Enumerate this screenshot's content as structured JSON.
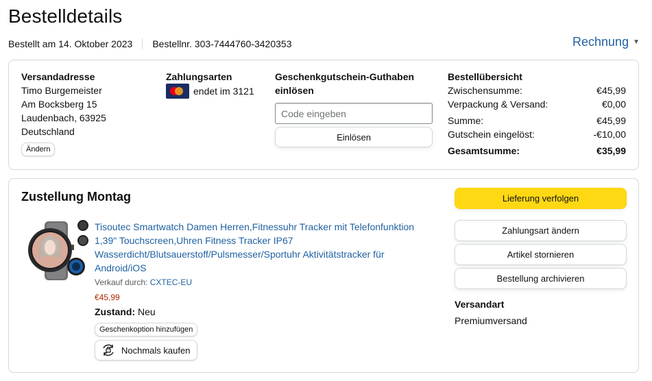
{
  "header": {
    "title": "Bestelldetails",
    "ordered_on": "Bestellt am 14. Oktober 2023",
    "order_number": "Bestellnr. 303-7444760-3420353",
    "invoice_label": "Rechnung"
  },
  "address": {
    "title": "Versandadresse",
    "name": "Timo Burgemeister",
    "street": "Am Bocksberg 15",
    "city": "Laudenbach, 63925",
    "country": "Deutschland",
    "change_label": "Ändern"
  },
  "payment": {
    "title": "Zahlungsarten",
    "card_text": "endet im 3121",
    "card_icon": "mastercard-icon"
  },
  "gift": {
    "title": "Geschenkgutschein-Guthaben einlösen",
    "placeholder": "Code eingeben",
    "redeem_label": "Einlösen"
  },
  "summary": {
    "title": "Bestellübersicht",
    "rows": [
      {
        "label": "Zwischensumme:",
        "value": "€45,99"
      },
      {
        "label": "Verpackung & Versand:",
        "value": "€0,00"
      },
      {
        "label": "Summe:",
        "value": "€45,99"
      },
      {
        "label": "Gutschein eingelöst:",
        "value": "-€10,00"
      }
    ],
    "total_label": "Gesamtsumme:",
    "total_value": "€35,99"
  },
  "delivery": {
    "title": "Zustellung Montag",
    "product": {
      "title": "Tisoutec Smartwatch Damen Herren,Fitnessuhr Tracker mit Telefonfunktion 1,39\" Touchscreen,Uhren Fitness Tracker IP67 Wasserdicht/Blutsauerstoff/Pulsmesser/Sportuhr Aktivitätstracker für Android/iOS",
      "seller_prefix": "Verkauf durch:",
      "seller": "CXTEC-EU",
      "price": "€45,99",
      "condition_label": "Zustand:",
      "condition_value": "Neu",
      "gift_option_label": "Geschenkoption hinzufügen",
      "buy_again_label": "Nochmals kaufen"
    },
    "actions": {
      "track": "Lieferung verfolgen",
      "change_payment": "Zahlungsart ändern",
      "cancel": "Artikel stornieren",
      "archive": "Bestellung archivieren"
    },
    "shipping_method_title": "Versandart",
    "shipping_method": "Premiumversand"
  },
  "colors": {
    "link": "#2162a1",
    "price": "#b12704",
    "primary_button": "#ffd814",
    "border": "#d5d9d9"
  }
}
